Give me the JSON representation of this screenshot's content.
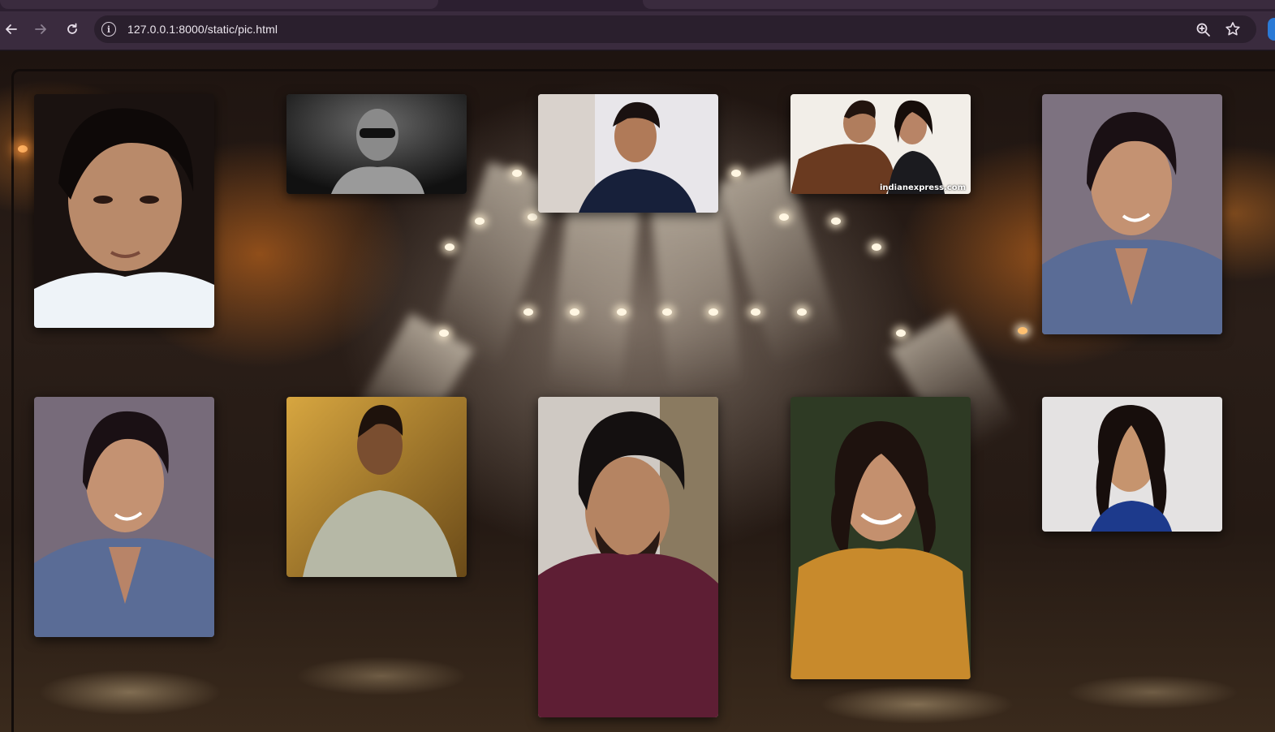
{
  "browser": {
    "url": "127.0.0.1:8000/static/pic.html",
    "back_icon": "arrow-left-icon",
    "forward_icon": "arrow-right-icon",
    "reload_icon": "reload-icon",
    "site_info_icon": "info-icon",
    "zoom_icon": "zoom-in-icon",
    "bookmark_icon": "star-icon"
  },
  "gallery": {
    "photos": [
      {
        "name": "photo-1",
        "caption": ""
      },
      {
        "name": "photo-2",
        "caption": ""
      },
      {
        "name": "photo-3",
        "caption": ""
      },
      {
        "name": "photo-4",
        "caption": "indianexpress.com"
      },
      {
        "name": "photo-5",
        "caption": ""
      },
      {
        "name": "photo-6",
        "caption": ""
      },
      {
        "name": "photo-7",
        "caption": ""
      },
      {
        "name": "photo-8",
        "caption": ""
      },
      {
        "name": "photo-9",
        "caption": ""
      },
      {
        "name": "photo-10",
        "caption": ""
      }
    ]
  },
  "colors": {
    "chrome_bg": "#3a2b3e",
    "omnibox_bg": "#2a1f2d",
    "stage_glow": "#e6781e"
  }
}
